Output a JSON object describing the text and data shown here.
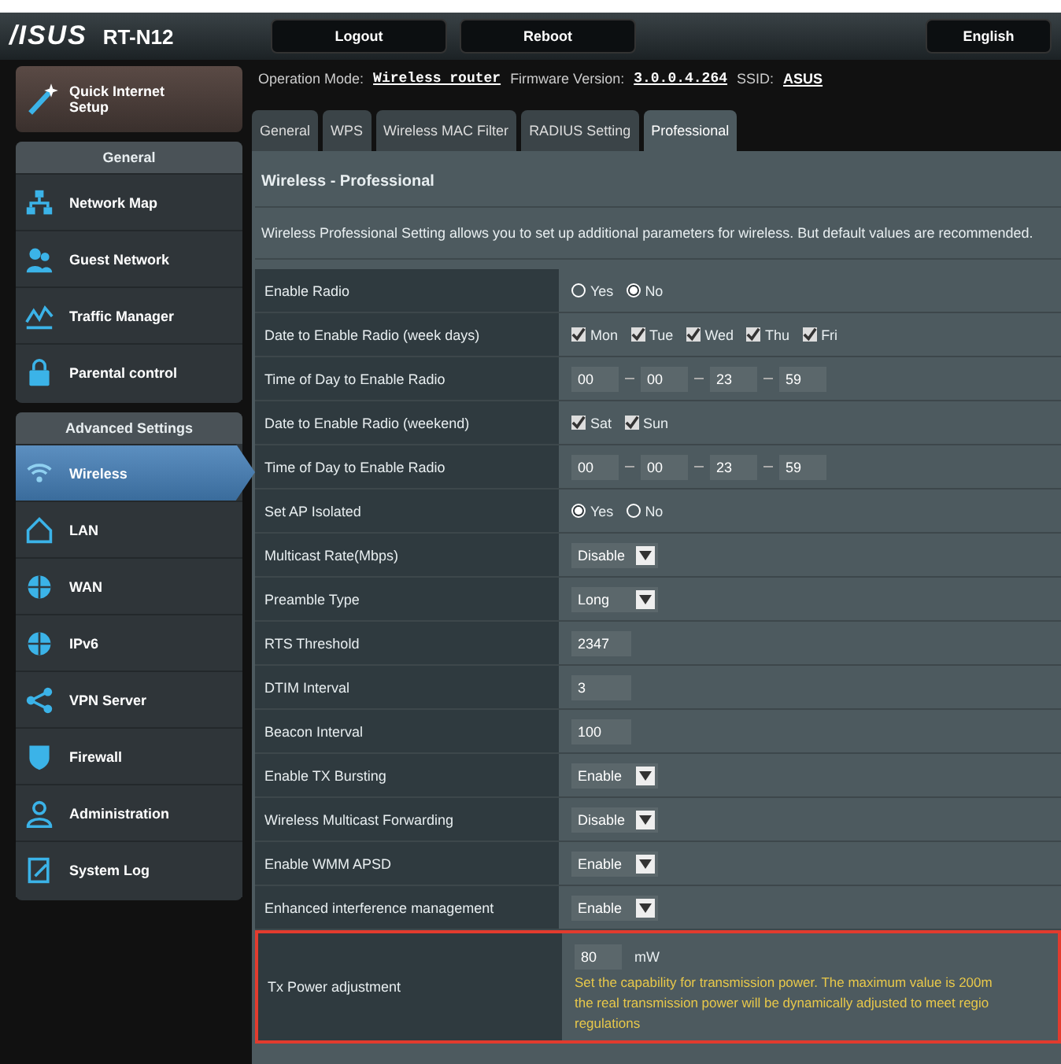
{
  "header": {
    "logo": "/ISUS",
    "model": "RT-N12",
    "buttons": [
      "Logout",
      "Reboot"
    ],
    "language": "English"
  },
  "sidebar": {
    "quick_setup": "Quick Internet Setup",
    "sections": [
      {
        "title": "General",
        "items": [
          {
            "label": "Network Map",
            "selected": false
          },
          {
            "label": "Guest Network",
            "selected": false
          },
          {
            "label": "Traffic Manager",
            "selected": false
          },
          {
            "label": "Parental control",
            "selected": false
          }
        ]
      },
      {
        "title": "Advanced Settings",
        "items": [
          {
            "label": "Wireless",
            "selected": true
          },
          {
            "label": "LAN",
            "selected": false
          },
          {
            "label": "WAN",
            "selected": false
          },
          {
            "label": "IPv6",
            "selected": false
          },
          {
            "label": "VPN Server",
            "selected": false
          },
          {
            "label": "Firewall",
            "selected": false
          },
          {
            "label": "Administration",
            "selected": false
          },
          {
            "label": "System Log",
            "selected": false
          }
        ]
      }
    ]
  },
  "status": {
    "operation_mode_label": "Operation Mode:",
    "operation_mode": "Wireless router",
    "firmware_label": "Firmware Version:",
    "firmware": "3.0.0.4.264",
    "ssid_label": "SSID:",
    "ssid": "ASUS"
  },
  "tabs": [
    {
      "label": "General",
      "selected": false
    },
    {
      "label": "WPS",
      "selected": false
    },
    {
      "label": "Wireless MAC Filter",
      "selected": false
    },
    {
      "label": "RADIUS Setting",
      "selected": false
    },
    {
      "label": "Professional",
      "selected": true
    }
  ],
  "panel": {
    "title": "Wireless - Professional",
    "description": "Wireless Professional Setting allows you to set up additional parameters for wireless. But default values are recommended."
  },
  "rows": [
    {
      "kind": "radio",
      "label": "Enable Radio",
      "options": [
        {
          "label": "Yes",
          "selected": false
        },
        {
          "label": "No",
          "selected": true
        }
      ]
    },
    {
      "kind": "checks",
      "label": "Date to Enable Radio (week days)",
      "options": [
        {
          "label": "Mon",
          "checked": true
        },
        {
          "label": "Tue",
          "checked": true
        },
        {
          "label": "Wed",
          "checked": true
        },
        {
          "label": "Thu",
          "checked": true
        },
        {
          "label": "Fri",
          "checked": true
        }
      ]
    },
    {
      "kind": "time",
      "label": "Time of Day to Enable Radio",
      "values": [
        "00",
        "00",
        "23",
        "59"
      ]
    },
    {
      "kind": "checks",
      "label": "Date to Enable Radio (weekend)",
      "options": [
        {
          "label": "Sat",
          "checked": true
        },
        {
          "label": "Sun",
          "checked": true
        }
      ]
    },
    {
      "kind": "time",
      "label": "Time of Day to Enable Radio",
      "values": [
        "00",
        "00",
        "23",
        "59"
      ]
    },
    {
      "kind": "radio",
      "label": "Set AP Isolated",
      "options": [
        {
          "label": "Yes",
          "selected": true
        },
        {
          "label": "No",
          "selected": false
        }
      ]
    },
    {
      "kind": "select",
      "label": "Multicast Rate(Mbps)",
      "value": "Disable"
    },
    {
      "kind": "select",
      "label": "Preamble Type",
      "value": "Long"
    },
    {
      "kind": "text",
      "label": "RTS Threshold",
      "value": "2347"
    },
    {
      "kind": "text",
      "label": "DTIM Interval",
      "value": "3"
    },
    {
      "kind": "text",
      "label": "Beacon Interval",
      "value": "100"
    },
    {
      "kind": "select",
      "label": "Enable TX Bursting",
      "value": "Enable"
    },
    {
      "kind": "select",
      "label": "Wireless Multicast Forwarding",
      "value": "Disable"
    },
    {
      "kind": "select",
      "label": "Enable WMM APSD",
      "value": "Enable"
    },
    {
      "kind": "select",
      "label": "Enhanced interference management",
      "value": "Enable"
    },
    {
      "kind": "power",
      "label": "Tx Power adjustment",
      "value": "80",
      "unit": "mW",
      "highlighted": true,
      "note_lines": [
        "Set the capability for transmission power. The maximum value is 200m",
        "the real transmission power will be dynamically adjusted to meet regio",
        "regulations"
      ]
    }
  ]
}
